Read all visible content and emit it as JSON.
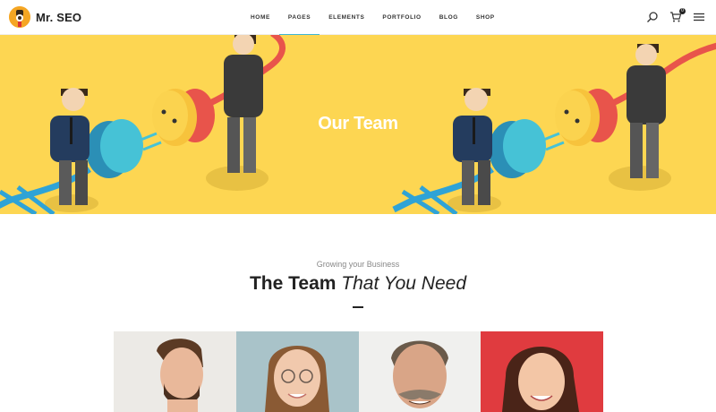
{
  "header": {
    "logo_text": "Mr. SEO",
    "nav": [
      {
        "label": "HOME"
      },
      {
        "label": "PAGES"
      },
      {
        "label": "ELEMENTS"
      },
      {
        "label": "PORTFOLIO"
      },
      {
        "label": "BLOG"
      },
      {
        "label": "SHOP"
      }
    ],
    "active_nav": "PAGES",
    "cart_count": "0",
    "icons": [
      "search-icon",
      "cart-icon",
      "menu-icon"
    ]
  },
  "hero": {
    "title": "Our Team",
    "background": "#fdd652"
  },
  "section": {
    "subtitle": "Growing your Business",
    "heading_bold": "The Team",
    "heading_italic": "That You Need"
  },
  "team": {
    "members": [
      {
        "photo": "man-profile-portrait",
        "bg": "#eceae6"
      },
      {
        "photo": "woman-glasses-portrait",
        "bg": "#a9c3c9"
      },
      {
        "photo": "man-mustache-portrait",
        "bg": "#f0f0ee"
      },
      {
        "photo": "woman-smiling-portrait",
        "bg": "#e03b3f"
      }
    ]
  },
  "colors": {
    "accent": "#3fb6d6",
    "hero_yellow": "#fdd652",
    "text_dark": "#222222"
  }
}
